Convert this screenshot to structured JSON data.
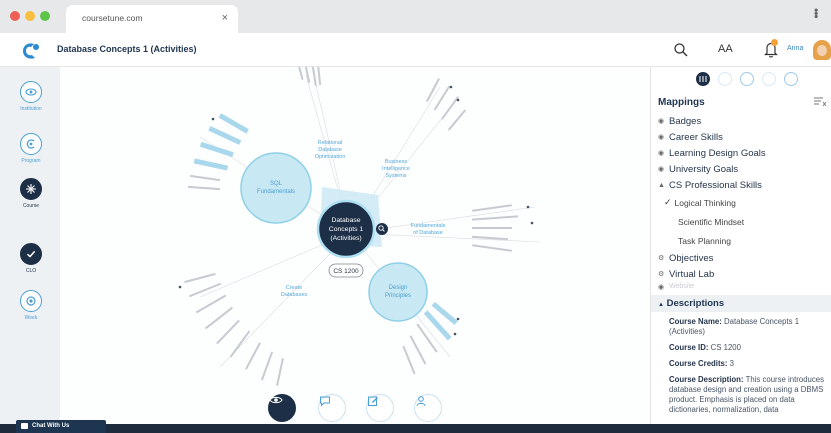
{
  "browser": {
    "tab_title": "coursetune.com",
    "tab_close": "×",
    "menu": "⋮"
  },
  "header": {
    "title": "Database Concepts 1 (Activities)",
    "font_size_label": "AA",
    "user_name": "Anna"
  },
  "rail": {
    "items": [
      {
        "label": "Institution"
      },
      {
        "label": "Program"
      },
      {
        "label": "Course"
      },
      {
        "label": "CLO"
      },
      {
        "label": "Week"
      }
    ]
  },
  "map": {
    "center": {
      "lines": [
        "Database",
        "Concepts 1",
        "(Activities)"
      ]
    },
    "course_id_tag": "CS 1200",
    "nodes": [
      {
        "lines": [
          "SQL",
          "Fundamentals"
        ]
      },
      {
        "lines": [
          "Design",
          "Principles"
        ]
      }
    ],
    "labels": [
      {
        "lines": [
          "Relational",
          "Database",
          "Optimization"
        ]
      },
      {
        "lines": [
          "Business",
          "Intelligence",
          "Systems"
        ]
      },
      {
        "lines": [
          "Fundamentals",
          "of Database"
        ]
      },
      {
        "lines": [
          "Create",
          "Databases"
        ]
      }
    ]
  },
  "sidebar": {
    "mappings_title": "Mappings",
    "mappings": [
      {
        "label": "Badges",
        "icon": "eye-icon"
      },
      {
        "label": "Career Skills",
        "icon": "eye-icon"
      },
      {
        "label": "Learning Design Goals",
        "icon": "eye-icon"
      },
      {
        "label": "University Goals",
        "icon": "eye-icon"
      },
      {
        "label": "CS Professional Skills",
        "icon": "caret-up-icon"
      }
    ],
    "sub_items": [
      {
        "label": "Logical Thinking",
        "checked": true
      },
      {
        "label": "Scientific Mindset",
        "checked": false
      },
      {
        "label": "Task Planning",
        "checked": false
      }
    ],
    "more": [
      {
        "label": "Objectives",
        "icon": "gear-icon"
      },
      {
        "label": "Virtual Lab",
        "icon": "gear-icon"
      },
      {
        "label": "Website",
        "icon": "eye-icon"
      }
    ],
    "descriptions_title": "Descriptions",
    "description": {
      "name_label": "Course Name:",
      "name_value": "Database Concepts 1 (Activities)",
      "id_label": "Course ID:",
      "id_value": "CS 1200",
      "credits_label": "Course Credits:",
      "credits_value": "3",
      "desc_label": "Course Description:",
      "desc_value": "This course introduces database design and creation using a DBMS product. Emphasis is placed on data dictionaries, normalization, data"
    }
  },
  "footer": {
    "chat_label": "Chat With Us"
  },
  "colors": {
    "navy": "#1d2f47",
    "node_fill": "#c8e9f3",
    "node_stroke": "#8fd0e6",
    "accent": "#4a9ed3",
    "label_blue": "#56a8d8"
  }
}
